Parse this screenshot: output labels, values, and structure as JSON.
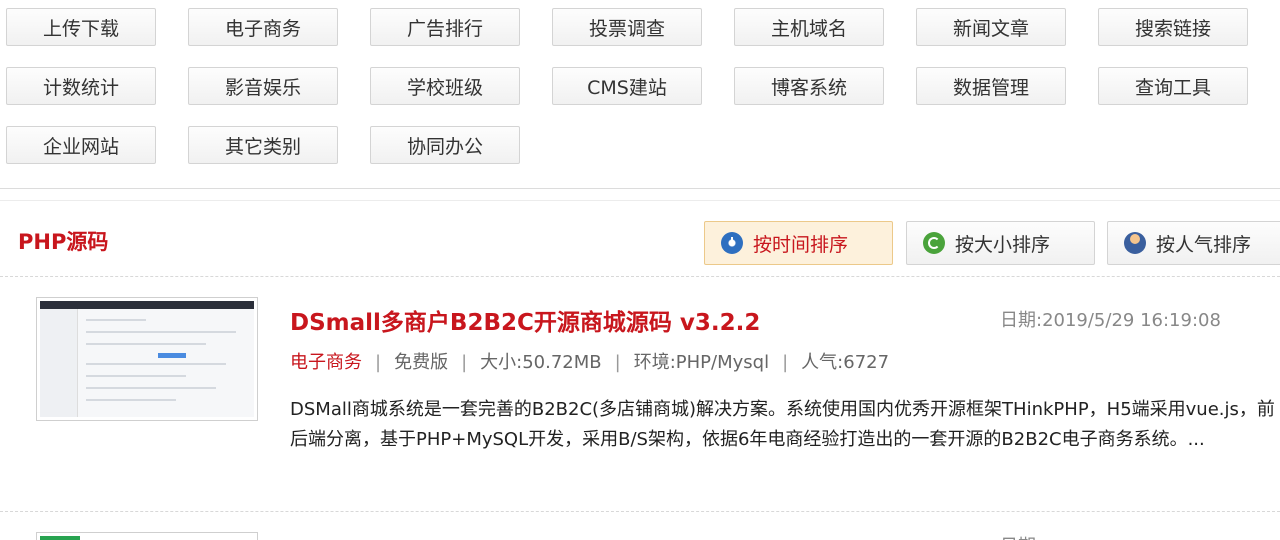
{
  "categories": [
    [
      "上传下载",
      "电子商务",
      "广告排行",
      "投票调查",
      "主机域名",
      "新闻文章",
      "搜索链接"
    ],
    [
      "计数统计",
      "影音娱乐",
      "学校班级",
      "CMS建站",
      "博客系统",
      "数据管理",
      "查询工具"
    ],
    [
      "企业网站",
      "其它类别",
      "协同办公"
    ]
  ],
  "section": {
    "title": "PHP源码",
    "sort": [
      {
        "label": "按时间排序",
        "icon": "clock-icon",
        "active": true
      },
      {
        "label": "按大小排序",
        "icon": "refresh-icon",
        "active": false
      },
      {
        "label": "按人气排序",
        "icon": "users-icon",
        "active": false
      }
    ]
  },
  "items": [
    {
      "title": "DSmall多商户B2B2C开源商城源码 v3.2.2",
      "date": "日期:2019/5/29 16:19:08",
      "category": "电子商务",
      "license": "免费版",
      "size": "大小:50.72MB",
      "env": "环境:PHP/Mysql",
      "popularity": "人气:6727",
      "desc": "DSMall商城系统是一套完善的B2B2C(多店铺商城)解决方案。系统使用国内优秀开源框架THinkPHP，H5端采用vue.js，前后端分离，基于PHP+MySQL开发，采用B/S架构，依据6年电商经验打造出的一套开源的B2B2C电子商务系统。..."
    }
  ],
  "next_item": {
    "date": "日期"
  },
  "colors": {
    "accent": "#c8161d",
    "active_bg": "#fdf1dc"
  }
}
